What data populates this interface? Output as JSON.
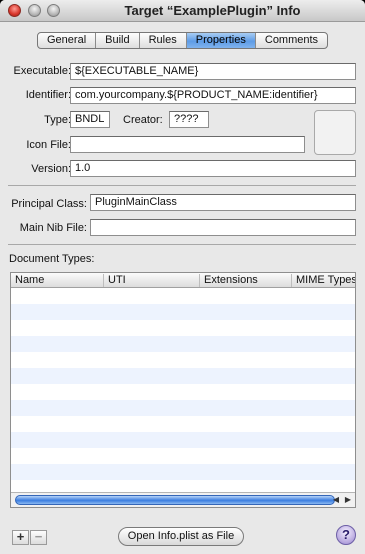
{
  "window": {
    "title": "Target “ExamplePlugin” Info"
  },
  "tabs": [
    {
      "label": "General"
    },
    {
      "label": "Build"
    },
    {
      "label": "Rules"
    },
    {
      "label": "Properties",
      "active": true
    },
    {
      "label": "Comments"
    }
  ],
  "form": {
    "executable_label": "Executable:",
    "executable_value": "${EXECUTABLE_NAME}",
    "identifier_label": "Identifier:",
    "identifier_value": "com.yourcompany.${PRODUCT_NAME:identifier}",
    "type_label": "Type:",
    "type_value": "BNDL",
    "creator_label": "Creator:",
    "creator_value": "????",
    "icon_file_label": "Icon File:",
    "icon_file_value": "",
    "version_label": "Version:",
    "version_value": "1.0",
    "principal_class_label": "Principal Class:",
    "principal_class_value": "PluginMainClass",
    "main_nib_label": "Main Nib File:",
    "main_nib_value": ""
  },
  "document_types": {
    "label": "Document Types:",
    "columns": [
      "Name",
      "UTI",
      "Extensions",
      "MIME Types"
    ],
    "rows": []
  },
  "footer": {
    "add_label": "+",
    "remove_label": "−",
    "open_plist_label": "Open Info.plist as File",
    "help_label": "?"
  },
  "colors": {
    "selected_tab": "#5e9ce6",
    "row_stripe": "#edf3fe"
  }
}
